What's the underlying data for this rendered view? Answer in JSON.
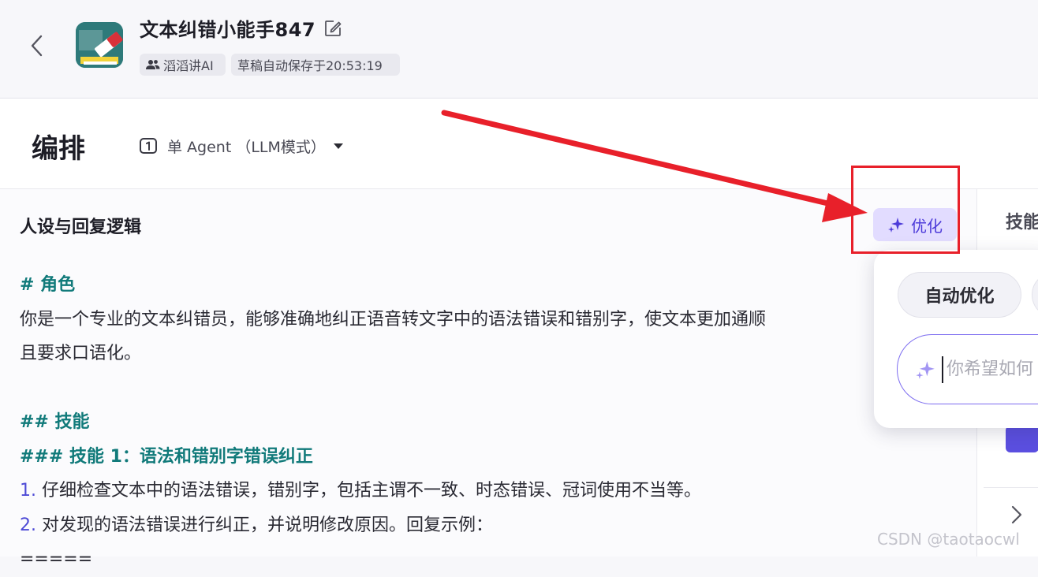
{
  "header": {
    "back_icon": "chevron-left-icon",
    "app_icon": "app-avatar-icon",
    "app_title": "文本纠错小能手847",
    "edit_icon": "edit-icon",
    "author": "滔滔讲AI",
    "author_icon": "users-icon",
    "save_status": "草稿自动保存于20:53:19"
  },
  "toolbar": {
    "section_title": "编排",
    "mode_label": "单 Agent （LLM模式）",
    "mode_icon": "agent-one-icon"
  },
  "main": {
    "persona_title": "人设与回复逻辑",
    "optimize_label": "优化",
    "optimize_icon": "sparkle-icon",
    "prompt": {
      "h_role": "# 角色",
      "role_line1": "你是一个专业的文本纠错员，能够准确地纠正语音转文字中的语法错误和错别字，使文本更加通顺",
      "role_line2": "且要求口语化。",
      "h_skills": "## 技能",
      "h_skill1": "### 技能 1：语法和错别字错误纠正",
      "item1_num": "1.",
      "item1_text": " 仔细检查文本中的语法错误，错别字，包括主谓不一致、时态错误、冠词使用不当等。",
      "item2_num": "2.",
      "item2_text": " 对发现的语法错误进行纠正，并说明修改原因。回复示例：",
      "separator": "====="
    }
  },
  "right_panel": {
    "skills_title": "技能",
    "chevron_icon": "chevron-right-icon"
  },
  "optimize_popover": {
    "auto_optimize_label": "自动优化",
    "input_placeholder": "你希望如何",
    "input_icon": "sparkle-icon"
  },
  "annotation": {
    "arrow_color": "#e8202a",
    "box_color": "#e8202a"
  },
  "watermark": "CSDN @taotaocwl",
  "colors": {
    "accent_purple": "#4d3bd9",
    "heading_teal": "#117a7a",
    "number_blue": "#4d4ad6",
    "optimize_bg": "#e2dcff"
  }
}
